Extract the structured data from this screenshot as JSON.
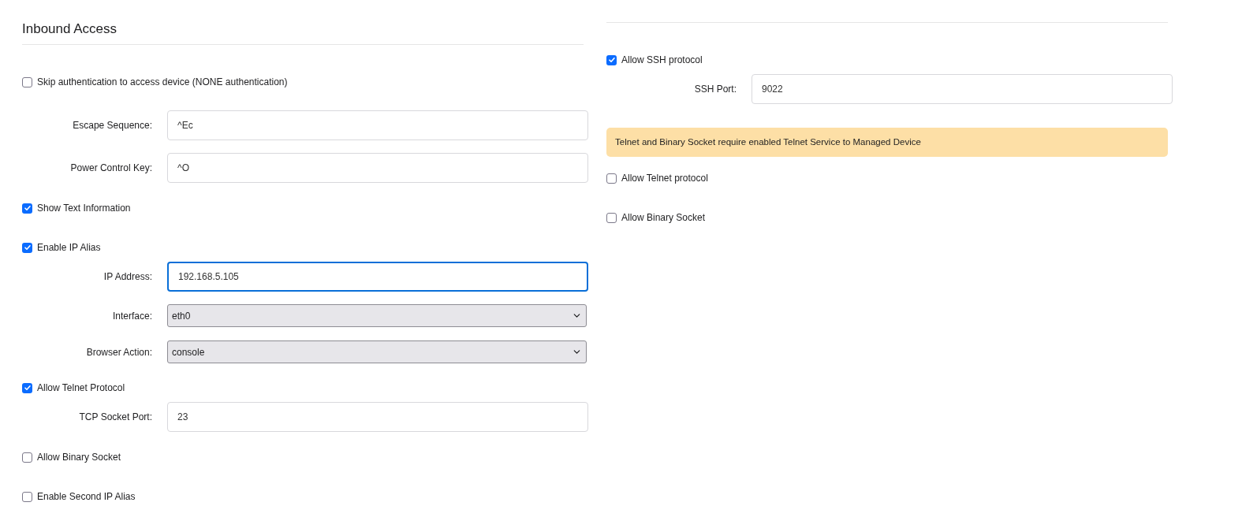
{
  "left": {
    "title": "Inbound Access",
    "items": [
      {
        "kind": "checkbox",
        "label": "Skip authentication to access device (NONE authentication)",
        "checked": false
      },
      {
        "kind": "field",
        "label": "Escape Sequence:",
        "value": "^Ec",
        "focused": false
      },
      {
        "kind": "field",
        "label": "Power Control Key:",
        "value": "^O",
        "focused": false
      },
      {
        "kind": "checkbox",
        "label": "Show Text Information",
        "checked": true
      },
      {
        "kind": "checkbox",
        "label": "Enable IP Alias",
        "checked": true,
        "children": [
          {
            "kind": "field",
            "label": "IP Address:",
            "value": "192.168.5.105",
            "focused": true
          },
          {
            "kind": "select",
            "label": "Interface:",
            "value": "eth0"
          },
          {
            "kind": "select",
            "label": "Browser Action:",
            "value": "console"
          },
          {
            "kind": "checkbox",
            "label": "Allow Telnet Protocol",
            "checked": true,
            "children": [
              {
                "kind": "field",
                "label": "TCP Socket Port:",
                "value": "23",
                "focused": false
              }
            ]
          },
          {
            "kind": "checkbox",
            "label": "Allow Binary Socket",
            "checked": false
          }
        ]
      },
      {
        "kind": "checkbox",
        "label": "Enable Second IP Alias",
        "checked": false
      }
    ]
  },
  "right": {
    "items": [
      {
        "kind": "checkbox",
        "label": "Allow SSH protocol",
        "checked": true,
        "children": [
          {
            "kind": "field",
            "label": "SSH Port:",
            "value": "9022",
            "focused": false
          }
        ]
      },
      {
        "kind": "alert",
        "text": "Telnet and Binary Socket require enabled Telnet Service to Managed Device"
      },
      {
        "kind": "checkbox",
        "label": "Allow Telnet protocol",
        "checked": false
      },
      {
        "kind": "checkbox",
        "label": "Allow Binary Socket",
        "checked": false
      }
    ]
  }
}
